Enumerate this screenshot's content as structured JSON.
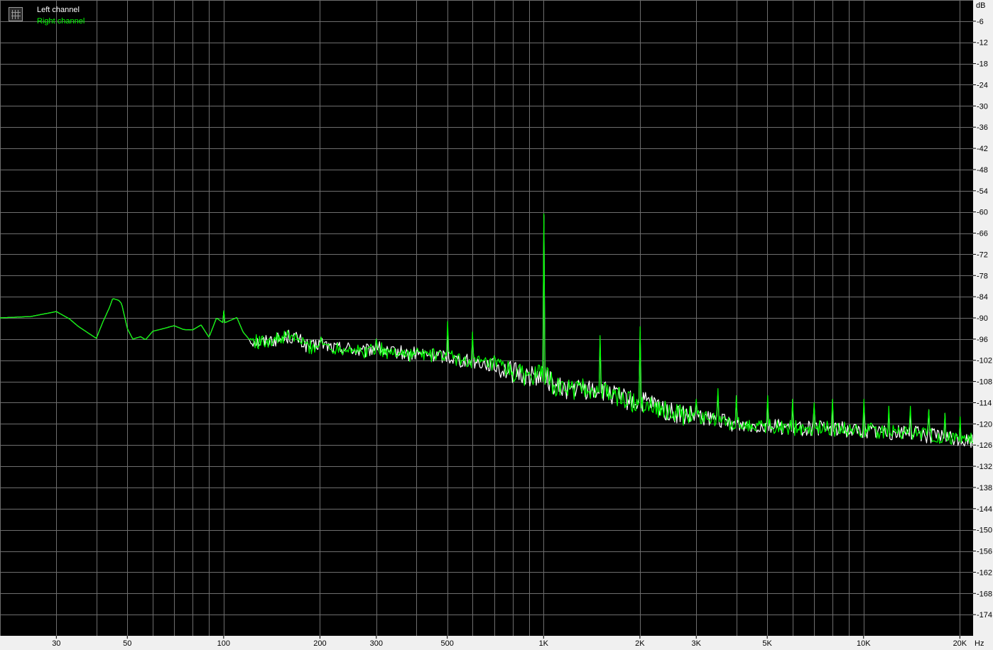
{
  "legend": {
    "left_label": "Left channel",
    "right_label": "Right channel",
    "left_color": "#ffffff",
    "right_color": "#00ff00",
    "icon": "graph-icon"
  },
  "colors": {
    "background": "#000000",
    "grid": "#6e6e6e",
    "axis_panel": "#f0f0f0"
  },
  "chart_data": {
    "type": "line",
    "x_scale": "log",
    "xlim": [
      20,
      22000
    ],
    "ylim": [
      -180,
      0
    ],
    "xunit": "Hz",
    "yunit": "dB",
    "grid": true,
    "legend_position": "top-left",
    "x_ticks": [
      {
        "v": 30,
        "label": "30"
      },
      {
        "v": 50,
        "label": "50"
      },
      {
        "v": 100,
        "label": "100"
      },
      {
        "v": 200,
        "label": "200"
      },
      {
        "v": 300,
        "label": "300"
      },
      {
        "v": 500,
        "label": "500"
      },
      {
        "v": 1000,
        "label": "1K"
      },
      {
        "v": 2000,
        "label": "2K"
      },
      {
        "v": 3000,
        "label": "3K"
      },
      {
        "v": 5000,
        "label": "5K"
      },
      {
        "v": 10000,
        "label": "10K"
      },
      {
        "v": 20000,
        "label": "20K"
      }
    ],
    "y_ticks": [
      -6,
      -12,
      -18,
      -24,
      -30,
      -36,
      -42,
      -48,
      -54,
      -60,
      -66,
      -72,
      -78,
      -84,
      -90,
      -96,
      -102,
      -108,
      -114,
      -120,
      -126,
      -132,
      -138,
      -144,
      -150,
      -156,
      -162,
      -168,
      -174
    ],
    "series": [
      {
        "name": "Left channel",
        "color": "#ffffff",
        "points": [
          [
            20,
            -90
          ],
          [
            25,
            -89.6
          ],
          [
            30,
            -88.2
          ],
          [
            33,
            -90.3
          ],
          [
            35,
            -92.3
          ],
          [
            40,
            -95.8
          ],
          [
            42,
            -91
          ],
          [
            44,
            -87
          ],
          [
            45,
            -84.5
          ],
          [
            47,
            -85
          ],
          [
            48,
            -86
          ],
          [
            50,
            -93
          ],
          [
            52,
            -96
          ],
          [
            55,
            -95.3
          ],
          [
            57,
            -96.2
          ],
          [
            60,
            -93.8
          ],
          [
            65,
            -93
          ],
          [
            70,
            -92.2
          ],
          [
            75,
            -93.3
          ],
          [
            80,
            -93.4
          ],
          [
            85,
            -92
          ],
          [
            90,
            -95.5
          ],
          [
            95,
            -90
          ],
          [
            100,
            -91.5
          ],
          [
            110,
            -89.9
          ],
          [
            115,
            -94
          ],
          [
            120,
            -96
          ],
          [
            130,
            -97
          ],
          [
            140,
            -96.2
          ],
          [
            150,
            -96
          ],
          [
            160,
            -95.2
          ],
          [
            170,
            -95.8
          ],
          [
            180,
            -97.7
          ],
          [
            190,
            -98.4
          ],
          [
            200,
            -97
          ],
          [
            220,
            -98.5
          ],
          [
            250,
            -98.5
          ],
          [
            270,
            -100
          ],
          [
            300,
            -98.2
          ],
          [
            330,
            -100.2
          ],
          [
            350,
            -99.5
          ],
          [
            380,
            -100.5
          ],
          [
            400,
            -100
          ],
          [
            450,
            -100.6
          ],
          [
            500,
            -100.8
          ],
          [
            550,
            -102
          ],
          [
            600,
            -102.2
          ],
          [
            700,
            -103.5
          ],
          [
            800,
            -105.4
          ],
          [
            900,
            -106.5
          ],
          [
            1000,
            -106
          ],
          [
            1100,
            -109.8
          ],
          [
            1200,
            -110
          ],
          [
            1300,
            -110.2
          ],
          [
            1500,
            -110.5
          ],
          [
            1700,
            -112.3
          ],
          [
            1900,
            -113.8
          ],
          [
            2100,
            -114
          ],
          [
            2300,
            -115.3
          ],
          [
            2500,
            -117
          ],
          [
            2800,
            -117.8
          ],
          [
            3000,
            -118.2
          ],
          [
            3500,
            -118.8
          ],
          [
            4000,
            -120.2
          ],
          [
            5000,
            -120.4
          ],
          [
            6000,
            -121.2
          ],
          [
            7000,
            -121.2
          ],
          [
            8000,
            -121.4
          ],
          [
            10000,
            -121.8
          ],
          [
            12000,
            -122.3
          ],
          [
            14000,
            -122.4
          ],
          [
            16000,
            -123.3
          ],
          [
            18000,
            -123.8
          ],
          [
            20000,
            -124.4
          ],
          [
            21000,
            -124.8
          ]
        ],
        "spikes": [
          [
            100,
            -88
          ],
          [
            300,
            -96
          ],
          [
            500,
            -93
          ],
          [
            600,
            -96
          ],
          [
            1000,
            -61
          ],
          [
            1500,
            -96
          ],
          [
            2000,
            -94
          ],
          [
            2500,
            -110
          ],
          [
            3000,
            -114
          ],
          [
            3500,
            -111
          ],
          [
            4000,
            -113
          ],
          [
            5000,
            -113
          ],
          [
            6000,
            -114
          ],
          [
            7000,
            -115
          ],
          [
            8000,
            -114
          ],
          [
            10000,
            -114
          ],
          [
            12000,
            -116
          ],
          [
            14000,
            -116
          ],
          [
            16000,
            -116
          ],
          [
            18000,
            -117
          ],
          [
            20000,
            -119
          ]
        ]
      },
      {
        "name": "Right channel",
        "color": "#00ff00",
        "points": [
          [
            20,
            -90
          ],
          [
            25,
            -89.6
          ],
          [
            30,
            -88.2
          ],
          [
            33,
            -90.3
          ],
          [
            35,
            -92.3
          ],
          [
            40,
            -95.8
          ],
          [
            42,
            -91
          ],
          [
            44,
            -87
          ],
          [
            45,
            -84.5
          ],
          [
            47,
            -85
          ],
          [
            48,
            -86
          ],
          [
            50,
            -93
          ],
          [
            52,
            -96
          ],
          [
            55,
            -95.3
          ],
          [
            57,
            -96.2
          ],
          [
            60,
            -93.8
          ],
          [
            65,
            -93
          ],
          [
            70,
            -92.2
          ],
          [
            75,
            -93.3
          ],
          [
            80,
            -93.4
          ],
          [
            85,
            -92
          ],
          [
            90,
            -95.5
          ],
          [
            95,
            -90
          ],
          [
            100,
            -91.5
          ],
          [
            110,
            -89.9
          ],
          [
            115,
            -94
          ],
          [
            120,
            -96
          ],
          [
            130,
            -97
          ],
          [
            140,
            -96.2
          ],
          [
            150,
            -96
          ],
          [
            160,
            -95.2
          ],
          [
            170,
            -95.8
          ],
          [
            180,
            -97.7
          ],
          [
            190,
            -98.4
          ],
          [
            200,
            -97
          ],
          [
            220,
            -98.5
          ],
          [
            250,
            -98.5
          ],
          [
            270,
            -100
          ],
          [
            300,
            -98.2
          ],
          [
            330,
            -100.2
          ],
          [
            350,
            -99.5
          ],
          [
            380,
            -100.5
          ],
          [
            400,
            -100
          ],
          [
            450,
            -100.6
          ],
          [
            500,
            -100.8
          ],
          [
            550,
            -102
          ],
          [
            600,
            -102.2
          ],
          [
            700,
            -103.5
          ],
          [
            800,
            -105.4
          ],
          [
            900,
            -106.5
          ],
          [
            1000,
            -106
          ],
          [
            1100,
            -109.8
          ],
          [
            1200,
            -110
          ],
          [
            1300,
            -110.2
          ],
          [
            1500,
            -110.5
          ],
          [
            1700,
            -112.3
          ],
          [
            1900,
            -113.8
          ],
          [
            2100,
            -114
          ],
          [
            2300,
            -115.3
          ],
          [
            2500,
            -117
          ],
          [
            2800,
            -117.8
          ],
          [
            3000,
            -118.2
          ],
          [
            3500,
            -118.8
          ],
          [
            4000,
            -120.2
          ],
          [
            5000,
            -120.4
          ],
          [
            6000,
            -121.2
          ],
          [
            7000,
            -121.2
          ],
          [
            8000,
            -121.4
          ],
          [
            10000,
            -121.8
          ],
          [
            12000,
            -122.3
          ],
          [
            14000,
            -122.4
          ],
          [
            16000,
            -123.3
          ],
          [
            18000,
            -123.8
          ],
          [
            20000,
            -124.4
          ],
          [
            21000,
            -124.8
          ]
        ],
        "spikes": [
          [
            100,
            -88
          ],
          [
            300,
            -96
          ],
          [
            500,
            -91
          ],
          [
            600,
            -94
          ],
          [
            1000,
            -60.5
          ],
          [
            1500,
            -95
          ],
          [
            2000,
            -92.5
          ],
          [
            2500,
            -109
          ],
          [
            3000,
            -113
          ],
          [
            3500,
            -110
          ],
          [
            4000,
            -112
          ],
          [
            5000,
            -112
          ],
          [
            6000,
            -113
          ],
          [
            7000,
            -114
          ],
          [
            8000,
            -113
          ],
          [
            10000,
            -113
          ],
          [
            12000,
            -115
          ],
          [
            14000,
            -115
          ],
          [
            16000,
            -116
          ],
          [
            18000,
            -117
          ],
          [
            20000,
            -118
          ]
        ]
      }
    ]
  }
}
